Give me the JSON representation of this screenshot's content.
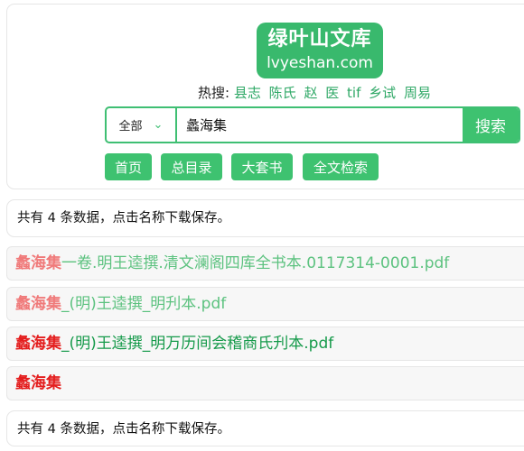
{
  "logo": {
    "title": "绿叶山文库",
    "domain": "lvyeshan.com"
  },
  "hot_search": {
    "label": "热搜:",
    "terms": [
      "县志",
      "陈氏",
      "赵",
      "医",
      "tif",
      "乡试",
      "周易"
    ]
  },
  "search": {
    "category": "全部",
    "query": "蠡海集",
    "button": "搜索"
  },
  "nav": [
    "首页",
    "总目录",
    "大套书",
    "全文检索"
  ],
  "summary": "共有 4 条数据，点击名称下载保存。",
  "results": [
    {
      "keyword": "蠡海集",
      "rest": "一卷.明王逵撰.清文澜阁四库全书本.0117314-0001.pdf",
      "keyword_color": "#f07a7a",
      "rest_color": "#5cc27f"
    },
    {
      "keyword": "蠡海集",
      "rest": "_(明)王逵撰_明刋本.pdf",
      "keyword_color": "#f07a7a",
      "rest_color": "#5cc27f"
    },
    {
      "keyword": "蠡海集",
      "rest": "_(明)王逵撰_明万历间会稽商氏刋本.pdf",
      "keyword_color": "#e41e1e",
      "rest_color": "#159a4a"
    },
    {
      "keyword": "蠡海集",
      "rest": "",
      "keyword_color": "#e41e1e",
      "rest_color": "#159a4a"
    }
  ],
  "colors": {
    "accent": "#3ec270",
    "hot_link": "#2fa866"
  }
}
